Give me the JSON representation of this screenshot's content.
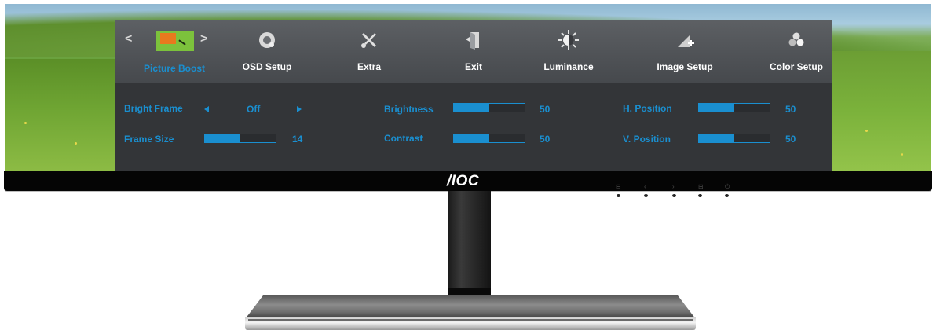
{
  "brand": {
    "logo_text": "/IOC"
  },
  "osd": {
    "tabs": [
      {
        "label": "Picture Boost",
        "icon": "picture-boost-icon",
        "active": true
      },
      {
        "label": "OSD Setup",
        "icon": "osd-setup-icon",
        "active": false
      },
      {
        "label": "Extra",
        "icon": "extra-icon",
        "active": false
      },
      {
        "label": "Exit",
        "icon": "exit-icon",
        "active": false
      },
      {
        "label": "Luminance",
        "icon": "luminance-icon",
        "active": false
      },
      {
        "label": "Image Setup",
        "icon": "image-setup-icon",
        "active": false
      },
      {
        "label": "Color Setup",
        "icon": "color-setup-icon",
        "active": false
      }
    ],
    "nav": {
      "prev": "<",
      "next": ">"
    },
    "settings": {
      "bright_frame": {
        "label": "Bright Frame",
        "value": "Off"
      },
      "frame_size": {
        "label": "Frame Size",
        "value": "14",
        "level": 0.5
      },
      "brightness": {
        "label": "Brightness",
        "value": "50",
        "level": 0.5
      },
      "contrast": {
        "label": "Contrast",
        "value": "50",
        "level": 0.5
      },
      "h_position": {
        "label": "H. Position",
        "value": "50",
        "level": 0.5
      },
      "v_position": {
        "label": "V. Position",
        "value": "50",
        "level": 0.5
      }
    }
  },
  "colors": {
    "accent": "#1a8fd0",
    "osd_background": "#333538",
    "osd_header": "#505357"
  }
}
